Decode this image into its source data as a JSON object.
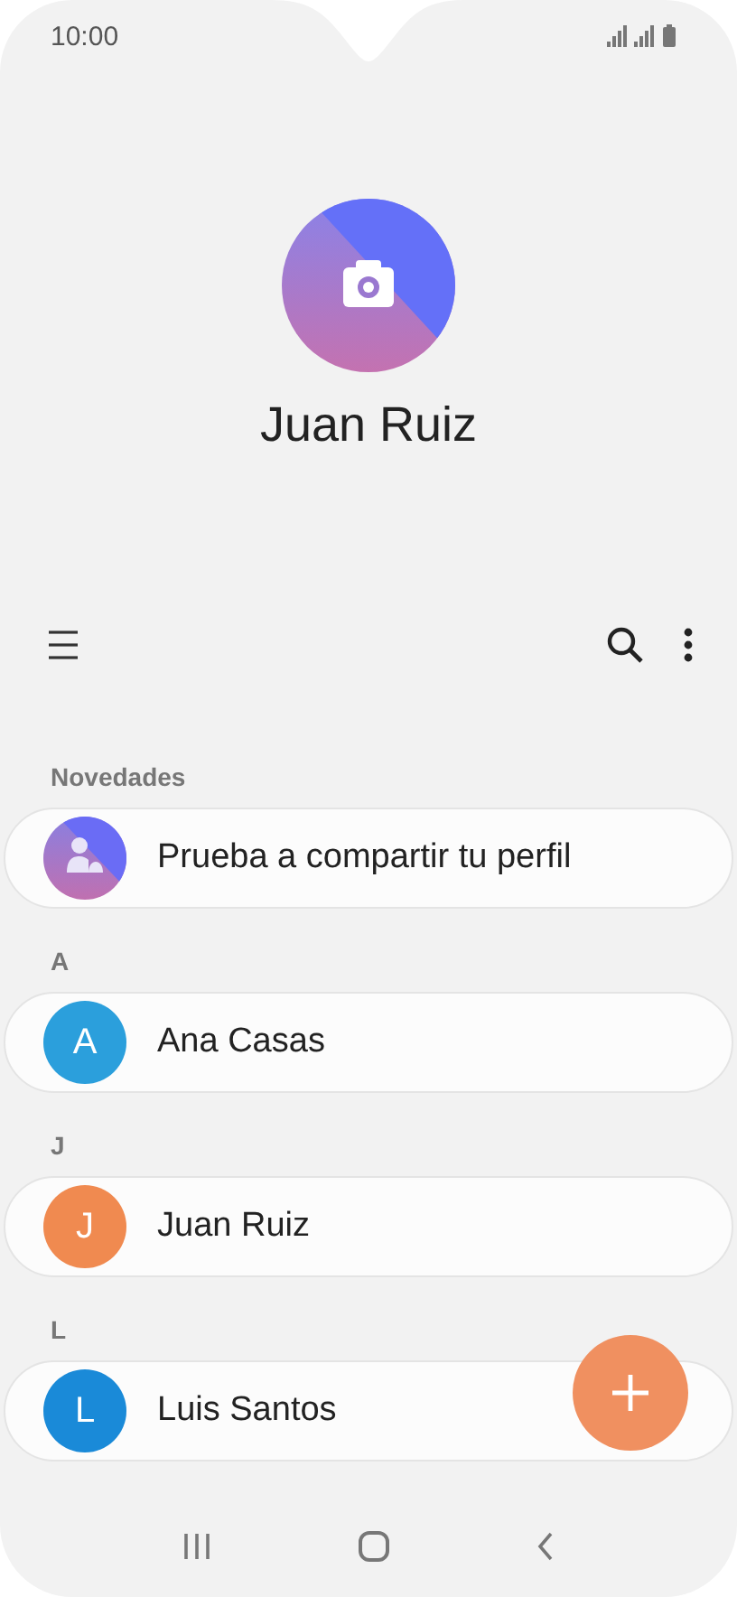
{
  "status_bar": {
    "time": "10:00"
  },
  "profile": {
    "name": "Juan Ruiz"
  },
  "sections": [
    {
      "header": "Novedades",
      "items": [
        {
          "kind": "suggestion",
          "text": "Prueba a compartir tu perfil"
        }
      ]
    },
    {
      "header": "A",
      "items": [
        {
          "kind": "contact",
          "initial": "A",
          "name": "Ana Casas",
          "color": "#2b9fdc"
        }
      ]
    },
    {
      "header": "J",
      "items": [
        {
          "kind": "contact",
          "initial": "J",
          "name": "Juan Ruiz",
          "color": "#f08a50"
        }
      ]
    },
    {
      "header": "L",
      "items": [
        {
          "kind": "contact",
          "initial": "L",
          "name": "Luis Santos",
          "color": "#1a8ad8"
        }
      ]
    }
  ]
}
